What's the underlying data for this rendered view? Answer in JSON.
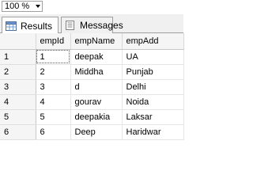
{
  "toolbar": {
    "zoom_value": "100 %"
  },
  "tabs": [
    {
      "label": "Results",
      "icon": "grid-icon"
    },
    {
      "label": "Messages",
      "icon": "document-icon"
    }
  ],
  "grid": {
    "columns": [
      "empId",
      "empName",
      "empAdd"
    ],
    "rows": [
      {
        "num": "1",
        "empId": "1",
        "empName": "deepak",
        "empAdd": "UA"
      },
      {
        "num": "2",
        "empId": "2",
        "empName": "Middha",
        "empAdd": "Punjab"
      },
      {
        "num": "3",
        "empId": "3",
        "empName": "d",
        "empAdd": "Delhi"
      },
      {
        "num": "4",
        "empId": "4",
        "empName": "gourav",
        "empAdd": "Noida"
      },
      {
        "num": "5",
        "empId": "5",
        "empName": "deepakia",
        "empAdd": "Laksar"
      },
      {
        "num": "6",
        "empId": "6",
        "empName": "Deep",
        "empAdd": "Haridwar"
      }
    ]
  }
}
